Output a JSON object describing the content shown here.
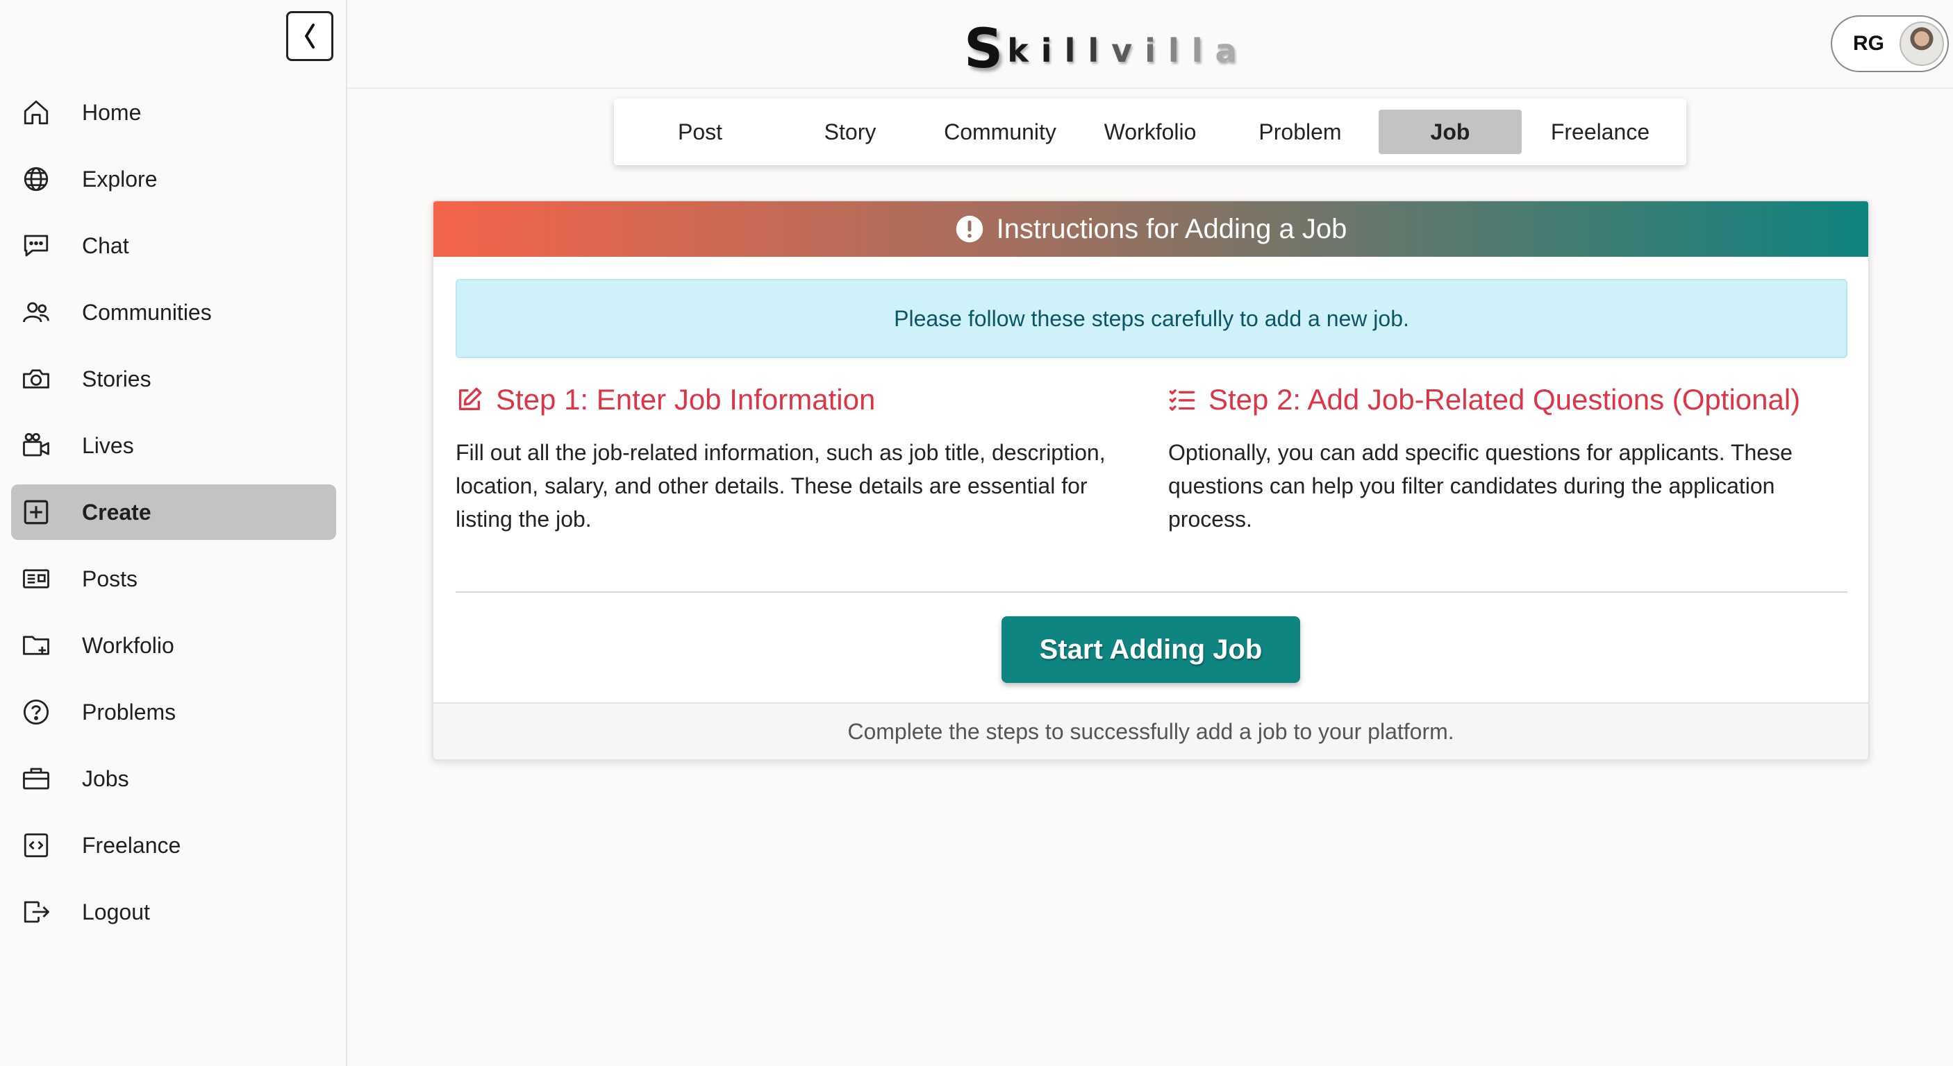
{
  "app": {
    "logo_first": "S",
    "logo_rest": [
      "k",
      "i",
      "l",
      "l",
      "v",
      "i",
      "l",
      "l",
      "a"
    ],
    "profile_initials": "RG"
  },
  "colors": {
    "accent_teal": "#0e8580",
    "step_red": "#dc3545",
    "info_bg": "#cff1f9",
    "active_bg": "#c3c3c3",
    "header_gradient_start": "#f4634a",
    "header_gradient_end": "#0e847e"
  },
  "sidebar": {
    "items": [
      {
        "label": "Home",
        "icon": "home-icon"
      },
      {
        "label": "Explore",
        "icon": "globe-icon"
      },
      {
        "label": "Chat",
        "icon": "chat-icon"
      },
      {
        "label": "Communities",
        "icon": "people-icon"
      },
      {
        "label": "Stories",
        "icon": "camera-icon"
      },
      {
        "label": "Lives",
        "icon": "video-camera-icon"
      },
      {
        "label": "Create",
        "icon": "plus-square-icon",
        "active": true
      },
      {
        "label": "Posts",
        "icon": "newspaper-icon"
      },
      {
        "label": "Workfolio",
        "icon": "folder-plus-icon"
      },
      {
        "label": "Problems",
        "icon": "question-circle-icon"
      },
      {
        "label": "Jobs",
        "icon": "briefcase-icon"
      },
      {
        "label": "Freelance",
        "icon": "code-square-icon"
      },
      {
        "label": "Logout",
        "icon": "logout-icon"
      }
    ]
  },
  "tabs": [
    {
      "label": "Post"
    },
    {
      "label": "Story"
    },
    {
      "label": "Community"
    },
    {
      "label": "Workfolio"
    },
    {
      "label": "Problem"
    },
    {
      "label": "Job",
      "active": true
    },
    {
      "label": "Freelance"
    }
  ],
  "card": {
    "title": "Instructions for Adding a Job",
    "info": "Please follow these steps carefully to add a new job.",
    "step1": {
      "title": "Step 1: Enter Job Information",
      "text": "Fill out all the job-related information, such as job title, description, location, salary, and other details. These details are essential for listing the job."
    },
    "step2": {
      "title": "Step 2: Add Job-Related Questions (Optional)",
      "text": "Optionally, you can add specific questions for applicants. These questions can help you filter candidates during the application process."
    },
    "button_label": "Start Adding Job",
    "footer": "Complete the steps to successfully add a job to your platform."
  }
}
